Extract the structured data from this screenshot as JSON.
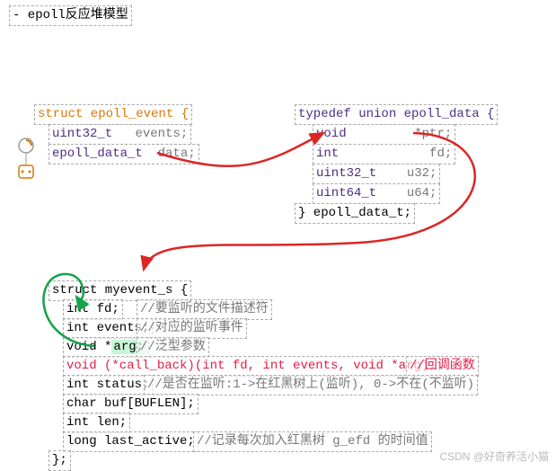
{
  "title": "- epoll反应堆模型",
  "left_struct": {
    "decl": "struct epoll_event {",
    "l1_type": "uint32_t",
    "l1_name": "events;",
    "l2_type": "epoll_data_t",
    "l2_name": "data;"
  },
  "right_struct": {
    "decl": "typedef union epoll_data {",
    "r1_t": "void",
    "r1_n": "*ptr;",
    "r2_t": "int",
    "r2_n": "fd;",
    "r3_t": "uint32_t",
    "r3_n": "u32;",
    "r4_t": "uint64_t",
    "r4_n": "u64;",
    "close": "} epoll_data_t;"
  },
  "bottom": {
    "decl": "struct myevent_s {",
    "l1": "int fd;",
    "c1": "//要监听的文件描述符",
    "l2": "int events;",
    "c2": "//对应的监听事件",
    "l3a": "void *",
    "l3b": "arg;",
    "c3": "//泛型参数",
    "l4": "void (*call_back)(int fd, int events, void *arg);",
    "c4": "//回调函数",
    "l5": "int status;",
    "c5": "//是否在监听:1->在红黑树上(监听), 0->不在(不监听)",
    "l6": "char buf[BUFLEN];",
    "l7": "int len;",
    "l8": "long last_active;",
    "c8": "//记录每次加入红黑树 g_efd 的时间值",
    "close": "};"
  },
  "watermark": "CSDN @好奇养活小猫"
}
